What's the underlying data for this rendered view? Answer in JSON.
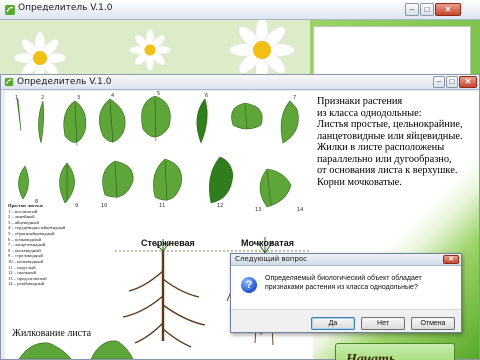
{
  "back_window": {
    "title": "Определитель V.1.0",
    "buttons": {
      "minimize": "–",
      "maximize": "□",
      "close": "✕"
    }
  },
  "front_window": {
    "title": "Определитель V.1.0",
    "buttons": {
      "minimize": "–",
      "maximize": "□",
      "close": "✕"
    }
  },
  "plate": {
    "leaf_numbers": [
      "1",
      "2",
      "3",
      "4",
      "5",
      "6",
      "7",
      "8",
      "9",
      "10",
      "11",
      "12",
      "13",
      "14"
    ],
    "legend_title": "Простые листья:",
    "legend_items": [
      "1 – игольчатый",
      "2 – линейный",
      "3 – яйцевидный",
      "4 – сердцевидно-яйцевидный",
      "5 – обратнояйцевидный",
      "6 – почковидный",
      "7 – ланцетовидный",
      "8 – копьевидный",
      "9 – стреловидный",
      "10 – копьевидный",
      "11 – округлый",
      "12 – овальный",
      "13 – продолговатый",
      "14 – ромбовидный"
    ],
    "root_labels": {
      "taproot": "Стержневая",
      "fibrous": "Мочковатая"
    },
    "venation_title": "Жилкование листа"
  },
  "info": {
    "text": "Признаки растения\nиз класса однодольные:\nЛистья простые, цельнокрайние,\nланцетовидные или яйцевидные.\nЖилки в листе расположены\nпараллельно или дугообразно,\nот основания листа к верхушке.\nКорни мочковатые."
  },
  "start_button": {
    "label": "Начать"
  },
  "dialog": {
    "title": "Следующий вопрос",
    "close": "✕",
    "icon": "question-icon",
    "message": "Определяемый биологический объект обладает признаками растения из класса однодольные?",
    "buttons": {
      "yes": "Да",
      "no": "Нет",
      "cancel": "Отмена"
    }
  },
  "colors": {
    "accent_green": "#57a82b",
    "leaf_green": "#4f9b2f",
    "dialog_default_border": "#3c7fb1"
  }
}
